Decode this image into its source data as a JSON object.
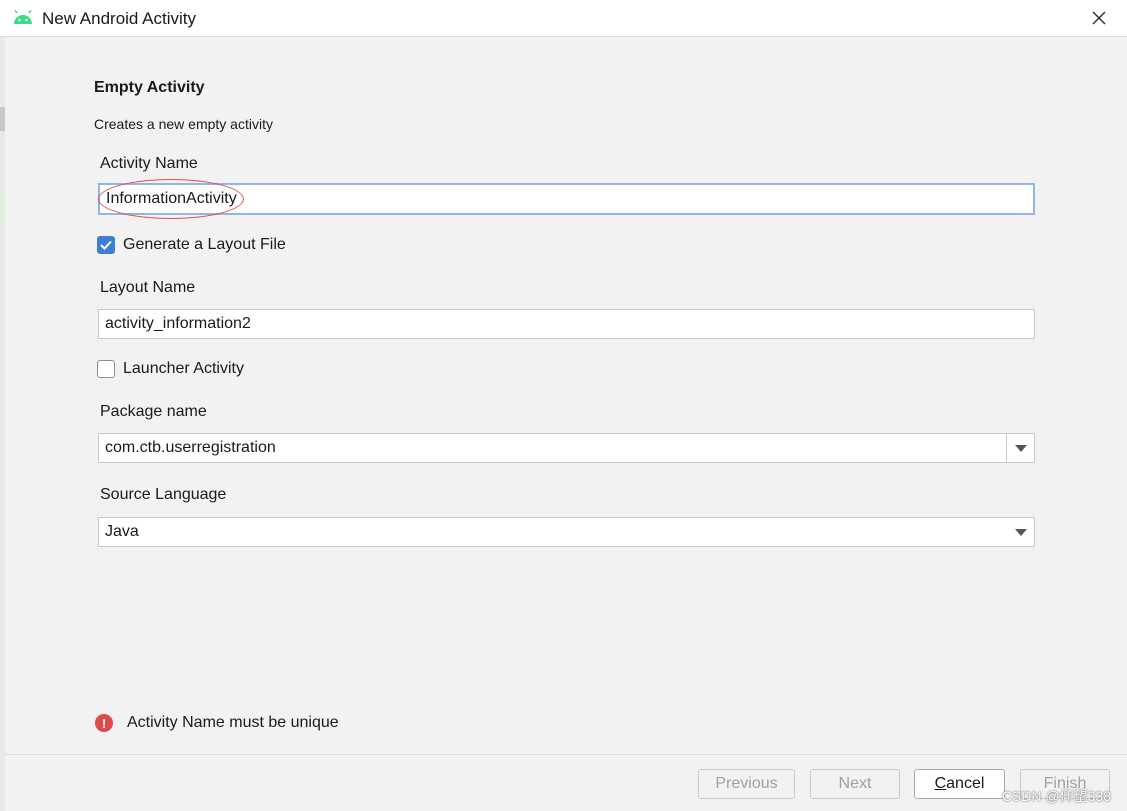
{
  "window": {
    "title": "New Android Activity"
  },
  "header": {
    "title": "Empty Activity",
    "subtitle": "Creates a new empty activity"
  },
  "form": {
    "activity_name": {
      "label": "Activity Name",
      "value": "InformationActivity"
    },
    "generate_layout": {
      "label": "Generate a Layout File",
      "checked": true
    },
    "layout_name": {
      "label": "Layout Name",
      "value": "activity_information2"
    },
    "launcher_activity": {
      "label": "Launcher Activity",
      "checked": false
    },
    "package_name": {
      "label": "Package name",
      "value": "com.ctb.userregistration"
    },
    "source_language": {
      "label": "Source Language",
      "value": "Java"
    }
  },
  "error": {
    "message": "Activity Name must be unique"
  },
  "buttons": {
    "previous": "Previous",
    "next": "Next",
    "cancel_rest": "ancel",
    "cancel_mnemonic": "C",
    "finish": "Finish"
  },
  "watermark": "CSDN @仰望338",
  "colors": {
    "accent": "#3d7fd6",
    "error": "#db4b4b",
    "android_green": "#3ddc84"
  }
}
